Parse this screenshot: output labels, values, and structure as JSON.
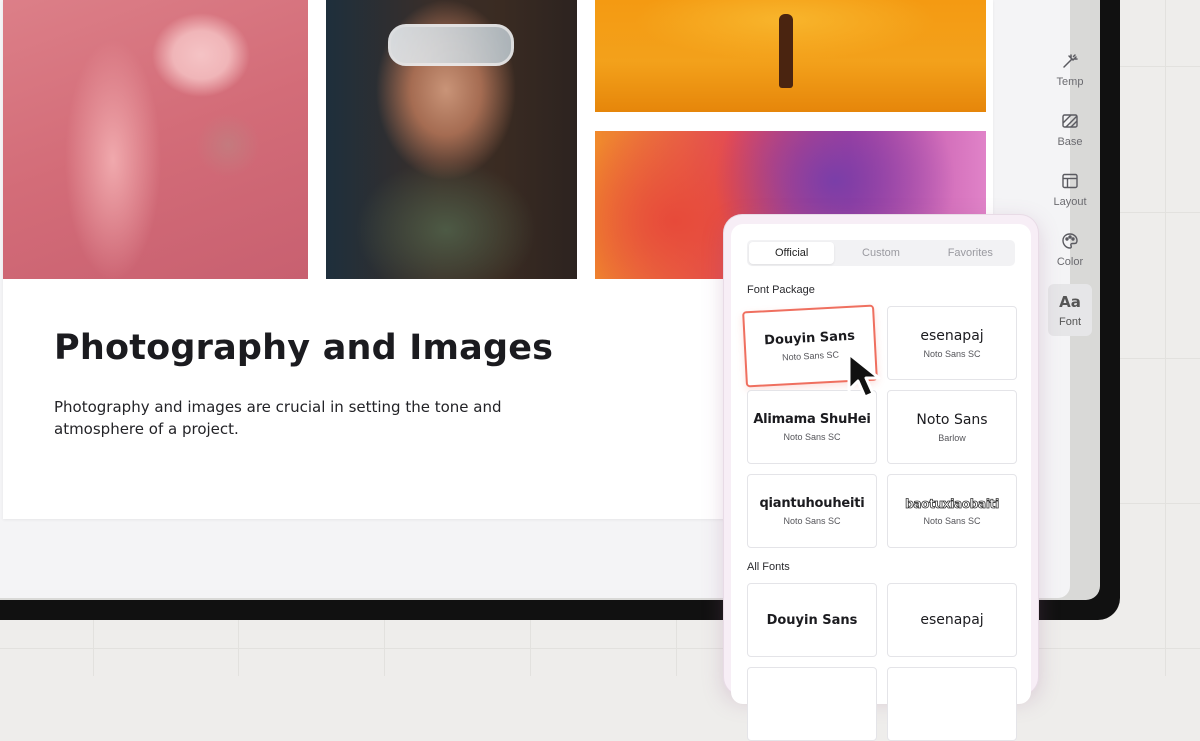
{
  "slide": {
    "title": "Photography and Images",
    "body": "Photography and images are crucial in setting the tone and atmosphere of a project."
  },
  "toolbar": {
    "items": [
      {
        "label": "Temp",
        "icon": "magic-wand-icon"
      },
      {
        "label": "Base",
        "icon": "hatched-square-icon"
      },
      {
        "label": "Layout",
        "icon": "layout-icon"
      },
      {
        "label": "Color",
        "icon": "palette-icon"
      },
      {
        "label": "Font",
        "icon": "aa-icon",
        "glyph": "Aa",
        "active": true
      }
    ]
  },
  "font_panel": {
    "tabs": [
      {
        "label": "Official",
        "active": true
      },
      {
        "label": "Custom"
      },
      {
        "label": "Favorites"
      }
    ],
    "font_package_label": "Font Package",
    "font_package": [
      {
        "name": "Douyin Sans",
        "sub": "Noto Sans SC",
        "selected": true
      },
      {
        "name": "esenapaj",
        "sub": "Noto Sans SC"
      },
      {
        "name": "Alimama ShuHei",
        "sub": "Noto Sans SC"
      },
      {
        "name": "Noto Sans",
        "sub": "Barlow"
      },
      {
        "name": "qiantuhouheiti",
        "sub": "Noto Sans SC"
      },
      {
        "name": "baotuxiaobaiti",
        "sub": "Noto Sans SC"
      }
    ],
    "all_fonts_label": "All Fonts",
    "all_fonts": [
      {
        "name": "Douyin Sans"
      },
      {
        "name": "esenapaj"
      }
    ]
  },
  "colors": {
    "accent": "#ef6f5f",
    "panel_glow": "#f7eef6"
  }
}
